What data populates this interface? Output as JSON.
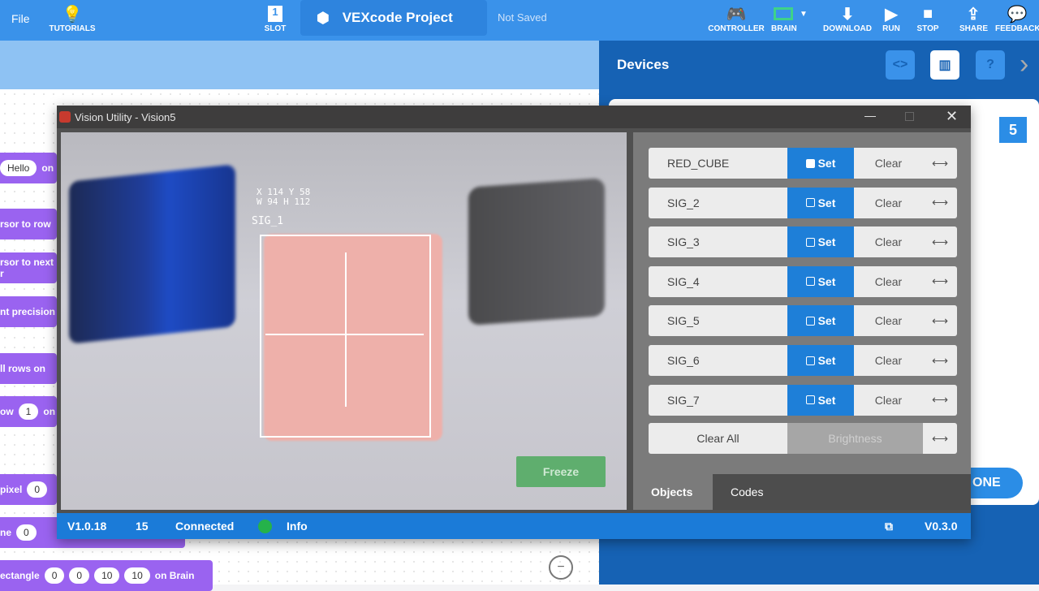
{
  "topbar": {
    "file": "File",
    "tutorials": "TUTORIALS",
    "slot": "SLOT",
    "slot_number": "1",
    "project_name": "VEXcode Project",
    "save_status": "Not Saved",
    "controller": "CONTROLLER",
    "brain": "BRAIN",
    "download": "DOWNLOAD",
    "run": "RUN",
    "stop": "STOP",
    "share": "SHARE",
    "feedback": "FEEDBACK"
  },
  "devices": {
    "title": "Devices",
    "port": "5",
    "done_partial": "ONE"
  },
  "blocks": {
    "b1_text": "Hello",
    "b1_on": "on",
    "b2": "rsor to row",
    "b3": "rsor to next r",
    "b4": "nt precision",
    "b5": "ll rows on",
    "b6": "ow",
    "b6_val": "1",
    "b6_on": "on",
    "b7": "pixel",
    "b7_val": "0",
    "b8": "ne",
    "b8_val": "0",
    "b9": "ectangle",
    "b9_vals": [
      "0",
      "0",
      "10",
      "10"
    ],
    "b9_on": "on Brain"
  },
  "vision": {
    "title": "Vision Utility - Vision5",
    "overlay_line1": "X 114 Y 58",
    "overlay_line2": "W 94 H 112",
    "overlay_sig": "SIG_1",
    "freeze": "Freeze",
    "signatures": [
      {
        "name": "RED_CUBE",
        "set": "Set",
        "clear": "Clear"
      },
      {
        "name": "SIG_2",
        "set": "Set",
        "clear": "Clear"
      },
      {
        "name": "SIG_3",
        "set": "Set",
        "clear": "Clear"
      },
      {
        "name": "SIG_4",
        "set": "Set",
        "clear": "Clear"
      },
      {
        "name": "SIG_5",
        "set": "Set",
        "clear": "Clear"
      },
      {
        "name": "SIG_6",
        "set": "Set",
        "clear": "Clear"
      },
      {
        "name": "SIG_7",
        "set": "Set",
        "clear": "Clear"
      }
    ],
    "clear_all": "Clear All",
    "brightness": "Brightness",
    "tabs": {
      "objects": "Objects",
      "codes": "Codes"
    },
    "status": {
      "version": "V1.0.18",
      "fps": "15",
      "connection": "Connected",
      "info": "Info",
      "fw_version": "V0.3.0"
    }
  }
}
